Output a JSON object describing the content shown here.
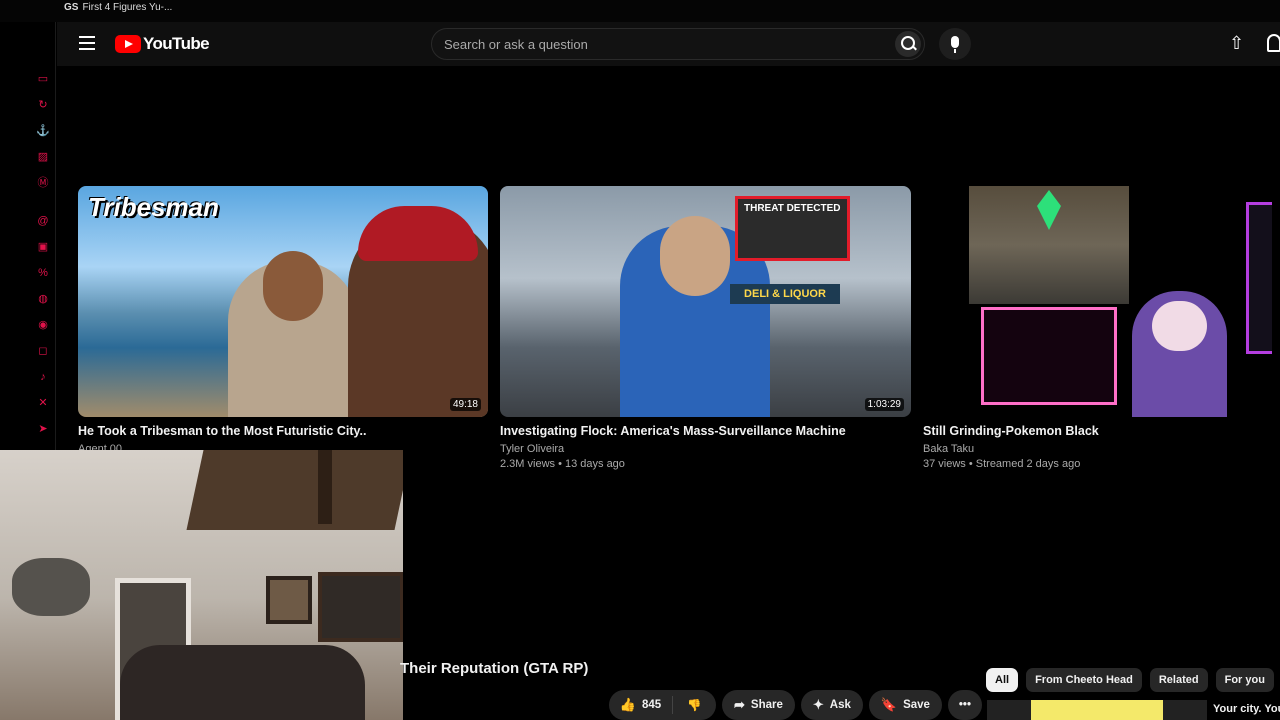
{
  "taskbar": {
    "tab_title": "First 4 Figures Yu-...",
    "tab_prefix": "GS"
  },
  "sidebar_icons": [
    "gamepad-icon",
    "refresh-icon",
    "anchor-icon",
    "card-icon",
    "m-icon",
    "threads-icon",
    "twitch-icon",
    "percent-icon",
    "whatsapp-icon",
    "discord-icon",
    "instagram-icon",
    "tiktok-icon",
    "x-icon",
    "telegram-icon"
  ],
  "header": {
    "logo_text": "YouTube",
    "search_placeholder": "Search or ask a question"
  },
  "videos": [
    {
      "thumb_text": "Tribesman",
      "duration": "49:18",
      "title": "He Took a Tribesman to the Most Futuristic City..",
      "channel": "Agent 00"
    },
    {
      "sign_text": "THREAT DETECTED",
      "store_text": "DELI & LIQUOR",
      "duration": "1:03:29",
      "title": "Investigating Flock: America's Mass-Surveillance Machine",
      "channel": "Tyler Oliveira",
      "stats": "2.3M views • 13 days ago"
    },
    {
      "title": "Still Grinding-Pokemon Black",
      "channel": "Baka Taku",
      "stats": "37 views • Streamed 2 days ago"
    }
  ],
  "player": {
    "title": "Their Reputation (GTA RP)",
    "like_count": "845",
    "share_label": "Share",
    "ask_label": "Ask",
    "save_label": "Save"
  },
  "chips": [
    "All",
    "From Cheeto Head",
    "Related",
    "For you",
    "R"
  ],
  "up_next": {
    "title": "Your city. Your"
  }
}
